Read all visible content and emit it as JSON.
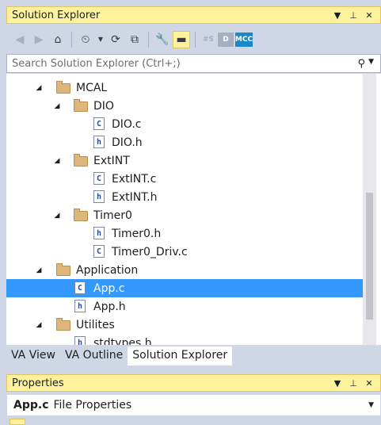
{
  "solution_explorer": {
    "title": "Solution Explorer",
    "title_icons": [
      "dropdown-icon",
      "pin-icon",
      "close-icon"
    ],
    "toolbar": [
      {
        "name": "back-icon",
        "glyph": "◀"
      },
      {
        "name": "forward-icon",
        "glyph": "▶"
      },
      {
        "name": "home-icon",
        "glyph": "⌂"
      },
      {
        "name": "pending-changes-icon",
        "glyph": "⏲"
      },
      {
        "name": "sync-icon",
        "glyph": "⟳"
      },
      {
        "name": "copy-icon",
        "glyph": "⧉"
      },
      {
        "name": "properties-wrench-icon",
        "glyph": "🔧"
      },
      {
        "name": "preview-icon",
        "glyph": "▬"
      },
      {
        "name": "va-hash-icon",
        "glyph": "#S"
      },
      {
        "name": "va-d-icon",
        "glyph": "D"
      },
      {
        "name": "mcc-icon",
        "glyph": "MCC"
      }
    ],
    "search": {
      "placeholder": "Search Solution Explorer (Ctrl+;)",
      "icon": "search-icon",
      "dropdown": "dropdown-icon"
    },
    "tree": [
      {
        "label": "MCAL",
        "kind": "folder",
        "expanded": true
      },
      {
        "label": "DIO",
        "kind": "folder",
        "expanded": true
      },
      {
        "label": "DIO.c",
        "kind": "file",
        "type": "C"
      },
      {
        "label": "DIO.h",
        "kind": "file",
        "type": "h"
      },
      {
        "label": "ExtINT",
        "kind": "folder",
        "expanded": true
      },
      {
        "label": "ExtINT.c",
        "kind": "file",
        "type": "C"
      },
      {
        "label": "ExtINT.h",
        "kind": "file",
        "type": "h"
      },
      {
        "label": "Timer0",
        "kind": "folder",
        "expanded": true
      },
      {
        "label": "Timer0.h",
        "kind": "file",
        "type": "h"
      },
      {
        "label": "Timer0_Driv.c",
        "kind": "file",
        "type": "C"
      },
      {
        "label": "Application",
        "kind": "folder",
        "expanded": true
      },
      {
        "label": "App.c",
        "kind": "file",
        "type": "C",
        "selected": true
      },
      {
        "label": "App.h",
        "kind": "file",
        "type": "h"
      },
      {
        "label": "Utilites",
        "kind": "folder",
        "expanded": true
      },
      {
        "label": "stdtypes.h",
        "kind": "file",
        "type": "h"
      }
    ],
    "tabs": [
      {
        "label": "VA View",
        "active": false
      },
      {
        "label": "VA Outline",
        "active": false
      },
      {
        "label": "Solution Explorer",
        "active": true
      }
    ]
  },
  "properties": {
    "title": "Properties",
    "title_icons": [
      "dropdown-icon",
      "pin-icon",
      "close-icon"
    ],
    "object_name": "App.c",
    "object_type": "File Properties"
  },
  "colors": {
    "title_active": "#fff29d",
    "selection": "#3399ff",
    "folder": "#dcb67a",
    "panel_bg": "#cfd6e5"
  }
}
